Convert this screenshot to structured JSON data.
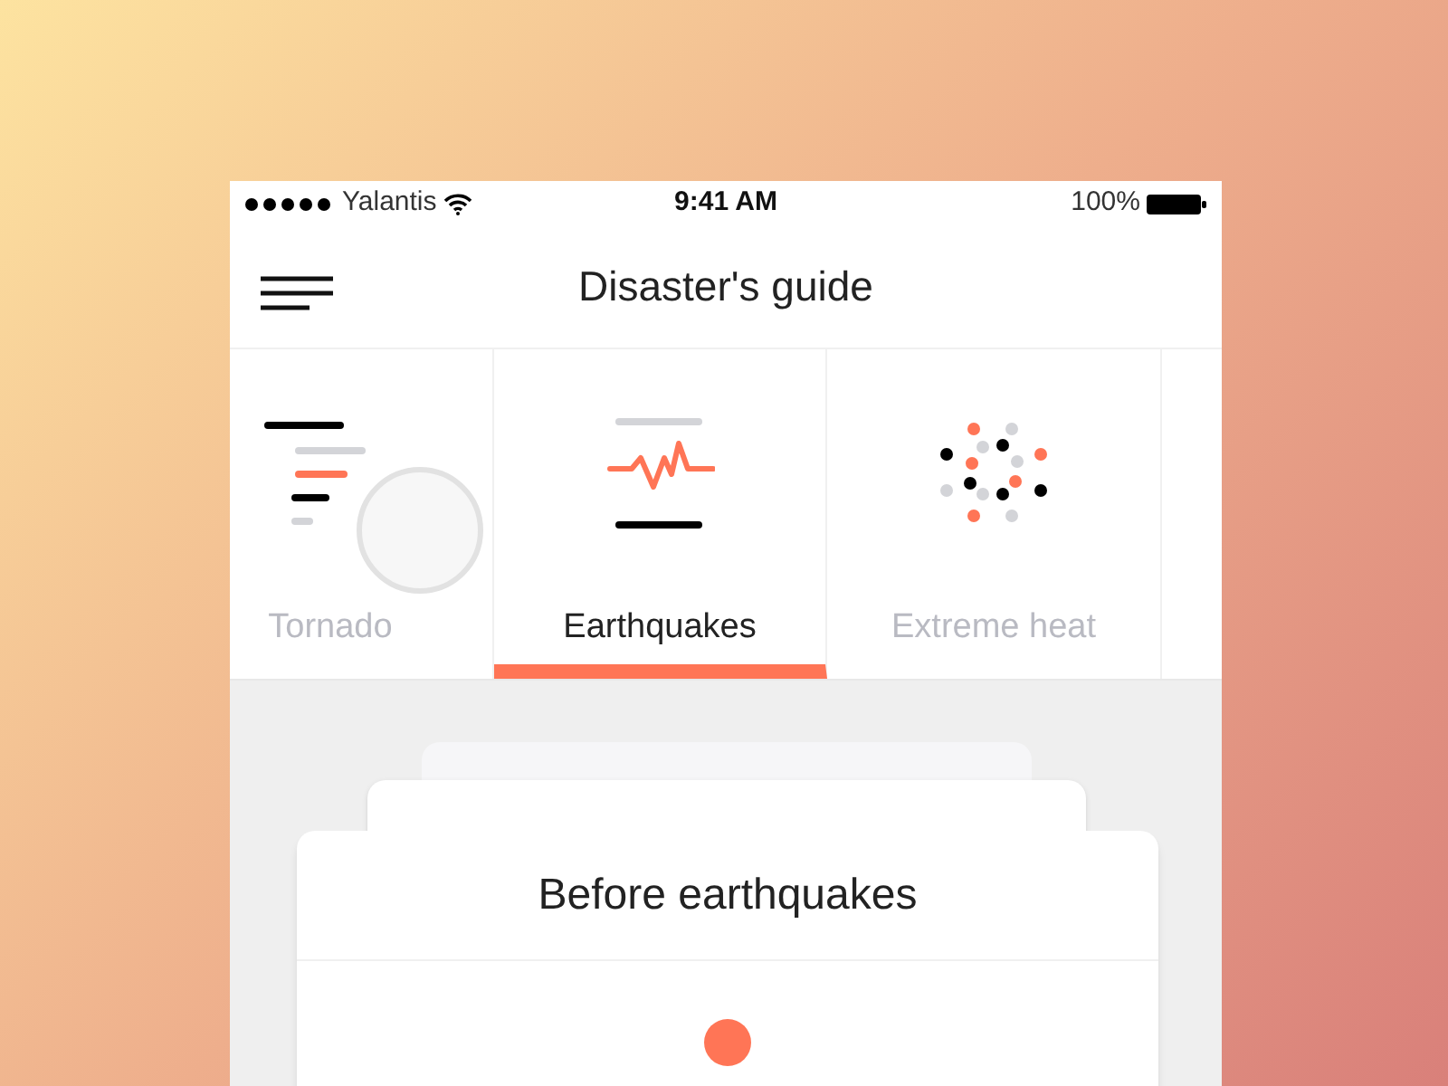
{
  "status_bar": {
    "carrier": "Yalantis",
    "time": "9:41 AM",
    "battery": "100%"
  },
  "header": {
    "title": "Disaster's guide"
  },
  "tabs": [
    {
      "label": "Tornado",
      "kind": "tornado",
      "selected": false
    },
    {
      "label": "Earthquakes",
      "kind": "earthquake",
      "selected": true
    },
    {
      "label": "Extreme heat",
      "kind": "heat",
      "selected": false
    }
  ],
  "card": {
    "title": "Before earthquakes"
  }
}
